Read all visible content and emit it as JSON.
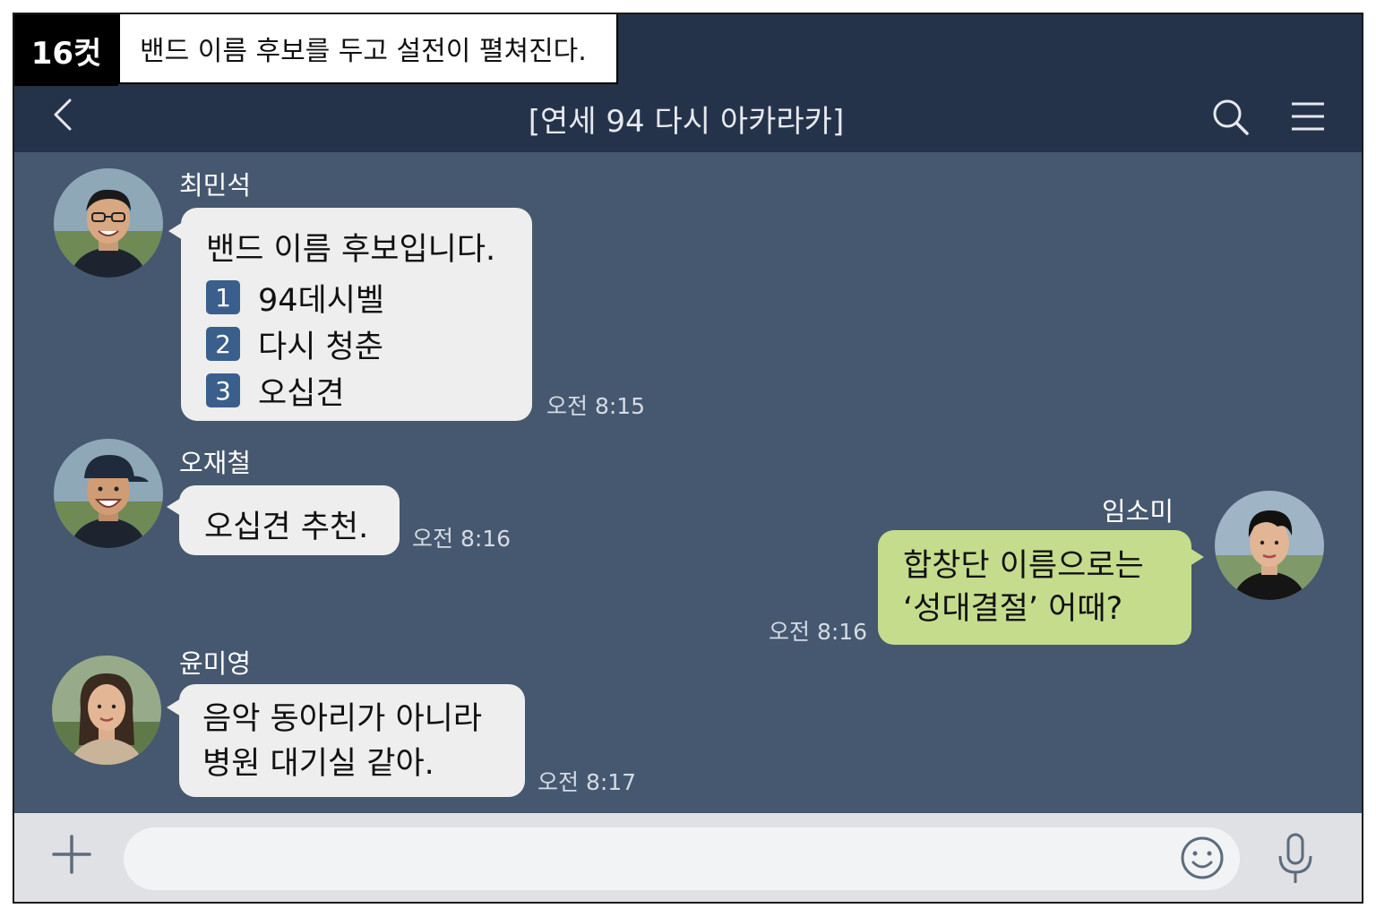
{
  "cut": {
    "label": "16컷",
    "caption": "밴드 이름 후보를 두고 설전이 펼쳐진다."
  },
  "header": {
    "title": "[연세 94 다시 아카라카]"
  },
  "messages": {
    "m1": {
      "sender": "최민석",
      "intro": "밴드 이름 후보입니다.",
      "options": [
        {
          "num": "1",
          "text": "94데시벨"
        },
        {
          "num": "2",
          "text": "다시 청춘"
        },
        {
          "num": "3",
          "text": "오십견"
        }
      ],
      "time": "오전 8:15"
    },
    "m2": {
      "sender": "오재철",
      "text": "오십견 추천.",
      "time": "오전 8:16"
    },
    "m3": {
      "sender": "임소미",
      "line1": "합창단 이름으로는",
      "line2": "‘성대결절’ 어때?",
      "time": "오전 8:16"
    },
    "m4": {
      "sender": "윤미영",
      "line1": "음악 동아리가 아니라",
      "line2": "병원 대기실 같아.",
      "time": "오전 8:17"
    }
  },
  "input": {
    "placeholder": ""
  },
  "colors": {
    "header": "#25334a",
    "chat_bg": "#46586f",
    "bubble": "#eeeeee",
    "my_bubble": "#c5dc8c",
    "badge": "#3a5f8c"
  },
  "icons": [
    "back-icon",
    "search-icon",
    "menu-icon",
    "plus-icon",
    "emoji-icon",
    "mic-icon"
  ]
}
